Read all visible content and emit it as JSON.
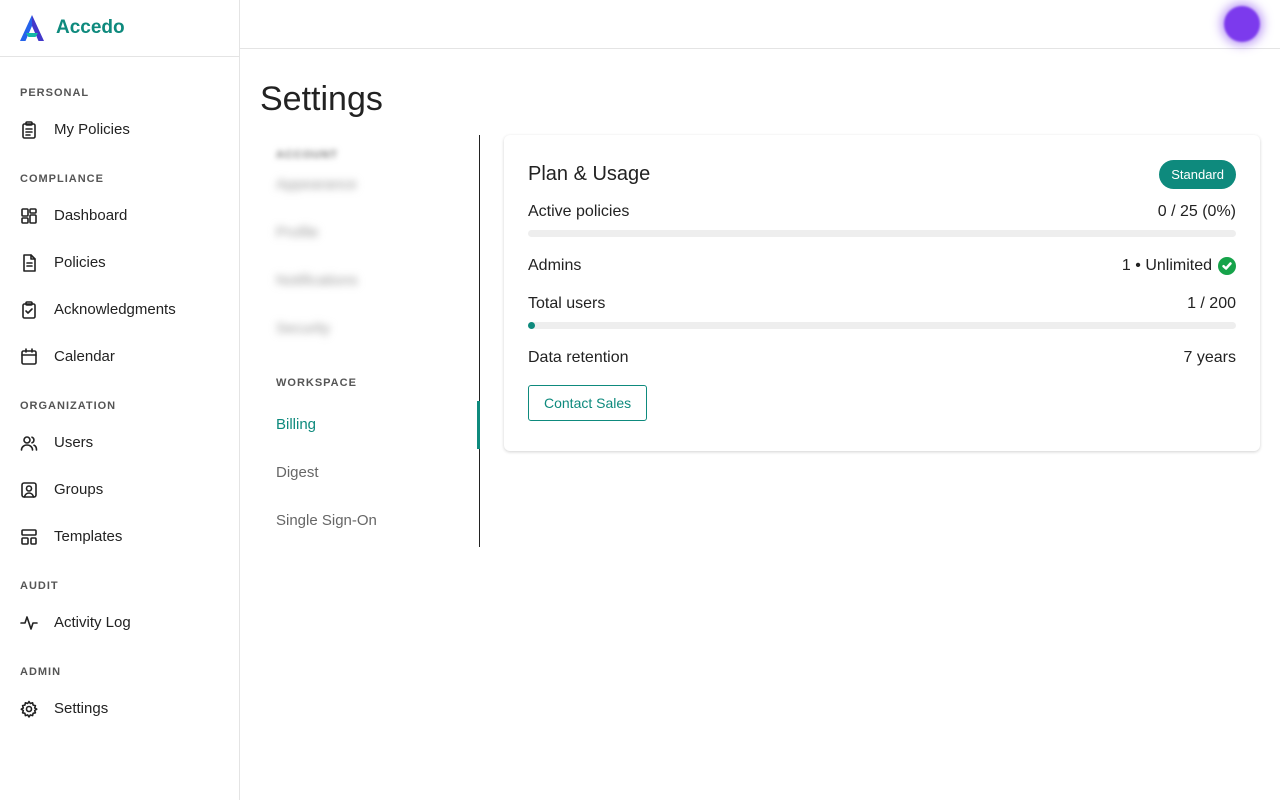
{
  "brand": {
    "name": "Accedo"
  },
  "sidebar": {
    "sections": [
      {
        "heading": "PERSONAL",
        "items": [
          {
            "label": "My Policies",
            "icon": "clipboard-icon"
          }
        ]
      },
      {
        "heading": "COMPLIANCE",
        "items": [
          {
            "label": "Dashboard",
            "icon": "dashboard-icon"
          },
          {
            "label": "Policies",
            "icon": "document-icon"
          },
          {
            "label": "Acknowledgments",
            "icon": "clipboard-check-icon"
          },
          {
            "label": "Calendar",
            "icon": "calendar-icon"
          }
        ]
      },
      {
        "heading": "ORGANIZATION",
        "items": [
          {
            "label": "Users",
            "icon": "users-icon"
          },
          {
            "label": "Groups",
            "icon": "group-icon"
          },
          {
            "label": "Templates",
            "icon": "templates-icon"
          }
        ]
      },
      {
        "heading": "AUDIT",
        "items": [
          {
            "label": "Activity Log",
            "icon": "activity-icon"
          }
        ]
      },
      {
        "heading": "ADMIN",
        "items": [
          {
            "label": "Settings",
            "icon": "gear-icon"
          }
        ]
      }
    ]
  },
  "page": {
    "title": "Settings"
  },
  "settings_nav": {
    "workspace_heading": "WORKSPACE",
    "workspace_items": [
      "Billing",
      "Digest",
      "Single Sign-On"
    ],
    "active": "Billing"
  },
  "plan": {
    "title": "Plan & Usage",
    "badge": "Standard",
    "active_policies": {
      "label": "Active policies",
      "value": "0 / 25 (0%)",
      "progress": 0
    },
    "admins": {
      "label": "Admins",
      "value": "1 • Unlimited"
    },
    "total_users": {
      "label": "Total users",
      "value": "1 / 200",
      "progress": 0.005
    },
    "data_retention": {
      "label": "Data retention",
      "value": "7 years"
    },
    "contact_button": "Contact Sales"
  },
  "colors": {
    "accent": "#0e8a7d",
    "avatar": "#7c3aed",
    "success": "#16a34a"
  }
}
